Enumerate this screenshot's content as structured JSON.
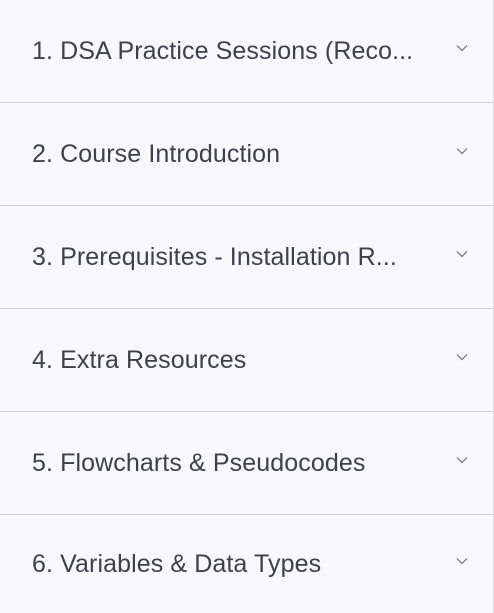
{
  "accordion": {
    "sections": [
      {
        "title": "1. DSA Practice Sessions (Reco...",
        "icon": "chevron-down-icon"
      },
      {
        "title": "2. Course Introduction",
        "icon": "chevron-down-icon"
      },
      {
        "title": "3. Prerequisites - Installation R...",
        "icon": "chevron-down-icon"
      },
      {
        "title": "4. Extra Resources",
        "icon": "chevron-down-icon"
      },
      {
        "title": "5. Flowcharts & Pseudocodes",
        "icon": "chevron-down-icon"
      },
      {
        "title": "6. Variables & Data Types",
        "icon": "chevron-down-icon"
      }
    ]
  }
}
